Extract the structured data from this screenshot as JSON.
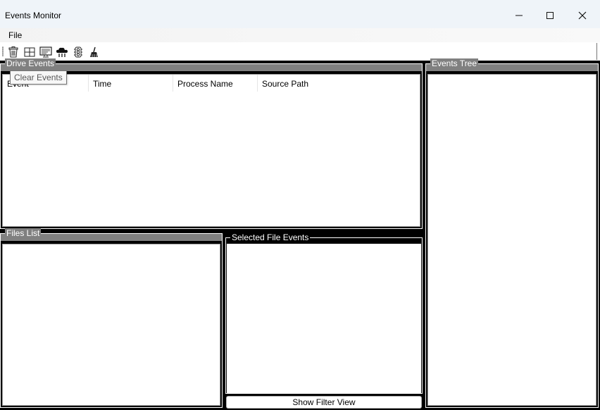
{
  "window": {
    "title": "Events Monitor",
    "controls": {
      "minimize": "minimize-icon",
      "maximize": "maximize-icon",
      "close": "close-icon"
    }
  },
  "menu": {
    "items": [
      {
        "label": "File"
      }
    ]
  },
  "toolbar": {
    "buttons": [
      {
        "icon": "trash-icon"
      },
      {
        "icon": "windows-icon"
      },
      {
        "icon": "monitor-icon"
      },
      {
        "icon": "cloud-icon"
      },
      {
        "icon": "traffic-light-icon"
      },
      {
        "icon": "broom-icon"
      }
    ],
    "tooltip": "Clear Events"
  },
  "drive_events": {
    "title": "Drive Events",
    "columns": [
      "Event",
      "Time",
      "Process Name",
      "Source Path"
    ]
  },
  "events_tree": {
    "title": "Events Tree"
  },
  "files_list": {
    "title": "Files List"
  },
  "selected_file_events": {
    "title": "Selected File Events",
    "filter_button": "Show Filter View"
  },
  "colors": {
    "band": "#808080",
    "background": "#000000",
    "panel": "#ffffff",
    "titlebar": "#eff4f9"
  }
}
